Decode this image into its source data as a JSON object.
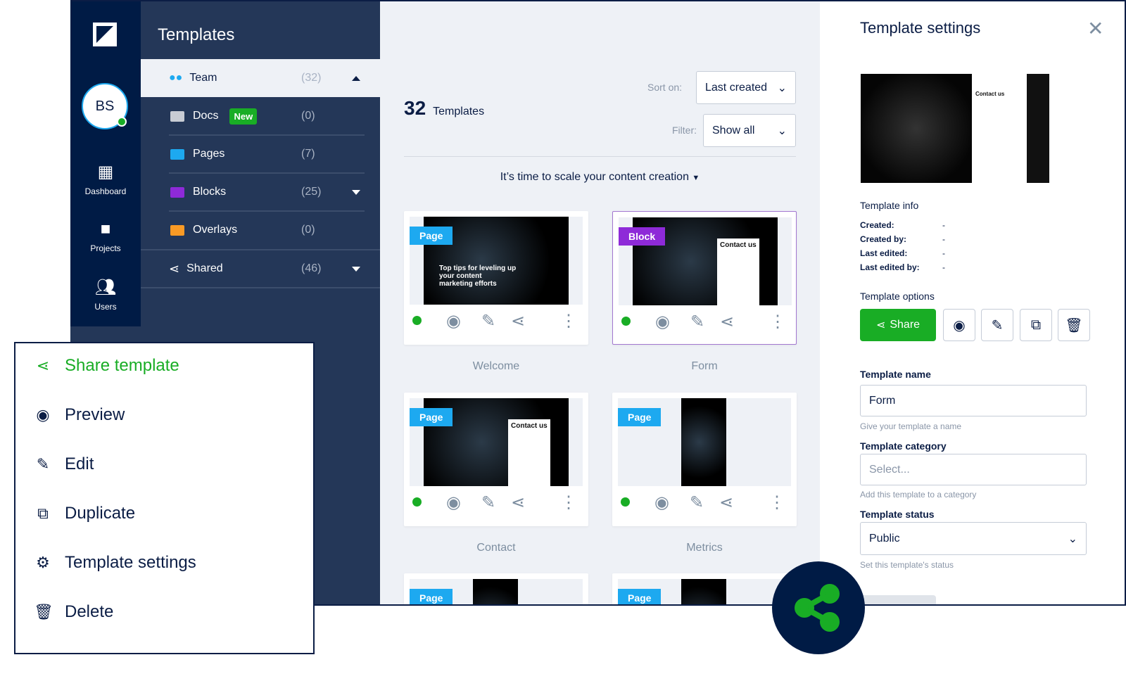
{
  "rail": {
    "avatar": "BS",
    "items": [
      {
        "label": "Dashboard",
        "icon": "dashboard-icon"
      },
      {
        "label": "Projects",
        "icon": "folder-icon"
      },
      {
        "label": "Users",
        "icon": "users-icon"
      }
    ]
  },
  "templates_panel": {
    "title": "Templates",
    "items": [
      {
        "label": "Team",
        "count": "(32)",
        "icon": "team-icon",
        "color": "#1da9f0",
        "expanded": true
      },
      {
        "label": "Docs",
        "count": "(0)",
        "badge": "New",
        "color": "#c8ccd4"
      },
      {
        "label": "Pages",
        "count": "(7)",
        "color": "#1da9f0"
      },
      {
        "label": "Blocks",
        "count": "(25)",
        "color": "#8e2ad8"
      },
      {
        "label": "Overlays",
        "count": "(0)",
        "color": "#f99a25"
      },
      {
        "label": "Shared",
        "count": "(46)",
        "icon": "share-icon"
      }
    ]
  },
  "main": {
    "count": "32",
    "count_label": "Templates",
    "sort_label": "Sort on:",
    "sort_value": "Last created",
    "filter_label": "Filter:",
    "filter_value": "Show all",
    "banner": "It’s time to scale your content creation",
    "cards": [
      {
        "name": "Welcome",
        "type": "Page",
        "thumb_text": "Top tips for leveling up your content marketing efforts"
      },
      {
        "name": "Form",
        "type": "Block",
        "thumb_text": "Contact us"
      },
      {
        "name": "Contact",
        "type": "Page",
        "thumb_text": "Contact us"
      },
      {
        "name": "Metrics",
        "type": "Page"
      },
      {
        "type": "Page"
      },
      {
        "type": "Page"
      }
    ]
  },
  "settings": {
    "title": "Template settings",
    "preview_text": "Contact us",
    "info_title": "Template info",
    "info": [
      {
        "k": "Created:",
        "v": "-"
      },
      {
        "k": "Created by:",
        "v": "-"
      },
      {
        "k": "Last edited:",
        "v": "-"
      },
      {
        "k": "Last edited by:",
        "v": "-"
      }
    ],
    "options_title": "Template options",
    "share_label": "Share",
    "name_label": "Template name",
    "name_value": "Form",
    "name_help": "Give your template a name",
    "category_label": "Template category",
    "category_placeholder": "Select...",
    "category_help": "Add this template to a category",
    "status_label": "Template status",
    "status_value": "Public",
    "status_help": "Set this template's status"
  },
  "menu": {
    "items": [
      {
        "label": "Share template",
        "icon": "share-icon",
        "color": "#19ad25"
      },
      {
        "label": "Preview",
        "icon": "eye-icon"
      },
      {
        "label": "Edit",
        "icon": "pencil-icon"
      },
      {
        "label": "Duplicate",
        "icon": "copy-icon"
      },
      {
        "label": "Template settings",
        "icon": "gear-icon"
      },
      {
        "label": "Delete",
        "icon": "trash-icon"
      }
    ]
  },
  "colors": {
    "navy": "#001b45",
    "panel": "#243758",
    "green": "#19ad25",
    "page_badge": "#1da9f0",
    "block_badge": "#8e2ad8"
  }
}
